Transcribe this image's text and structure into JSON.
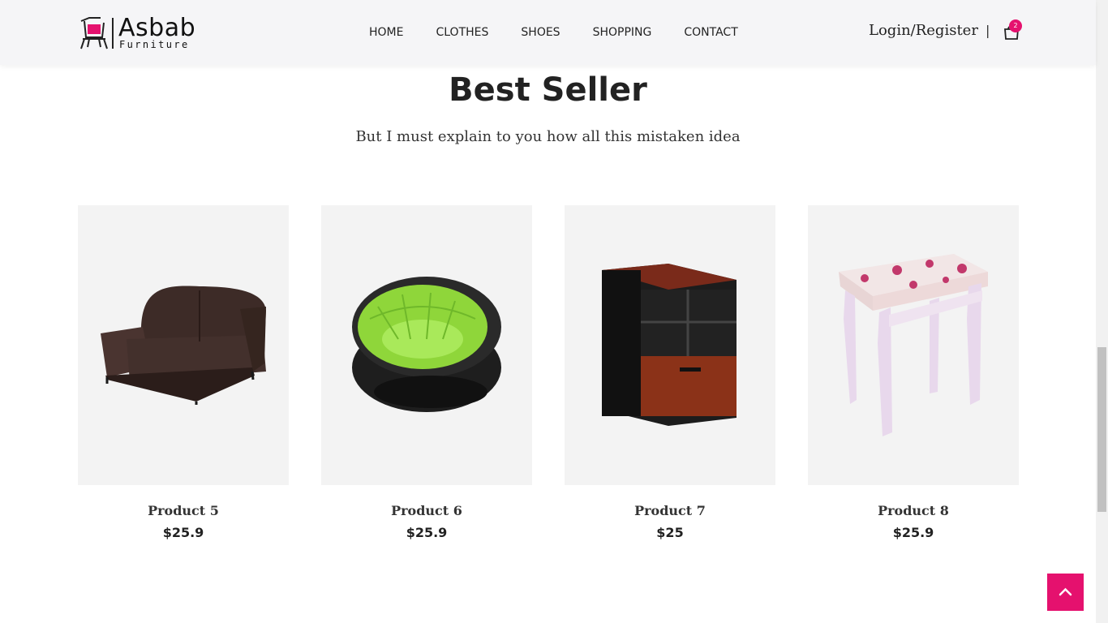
{
  "brand": {
    "name": "Asbab",
    "tagline": "Furniture",
    "accent": "#e5116e"
  },
  "nav": {
    "items": [
      {
        "label": "HOME"
      },
      {
        "label": "CLOTHES"
      },
      {
        "label": "SHOES"
      },
      {
        "label": "SHOPPING"
      },
      {
        "label": "CONTACT"
      }
    ]
  },
  "header": {
    "login_label": "Login/Register",
    "separator": "|",
    "cart_count": "2"
  },
  "section": {
    "title": "Best Seller",
    "subtitle": "But I must explain to you how all this mistaken idea"
  },
  "products": [
    {
      "name": "Product 5",
      "price": "$25.9",
      "image": "leather-loveseat"
    },
    {
      "name": "Product 6",
      "price": "$25.9",
      "image": "inflatable-green-chair"
    },
    {
      "name": "Product 7",
      "price": "$25",
      "image": "wooden-file-cabinet"
    },
    {
      "name": "Product 8",
      "price": "$25.9",
      "image": "floral-vanity-stool"
    }
  ],
  "icons": {
    "cart": "shopping-bag-icon",
    "to_top": "chevron-up-icon"
  }
}
